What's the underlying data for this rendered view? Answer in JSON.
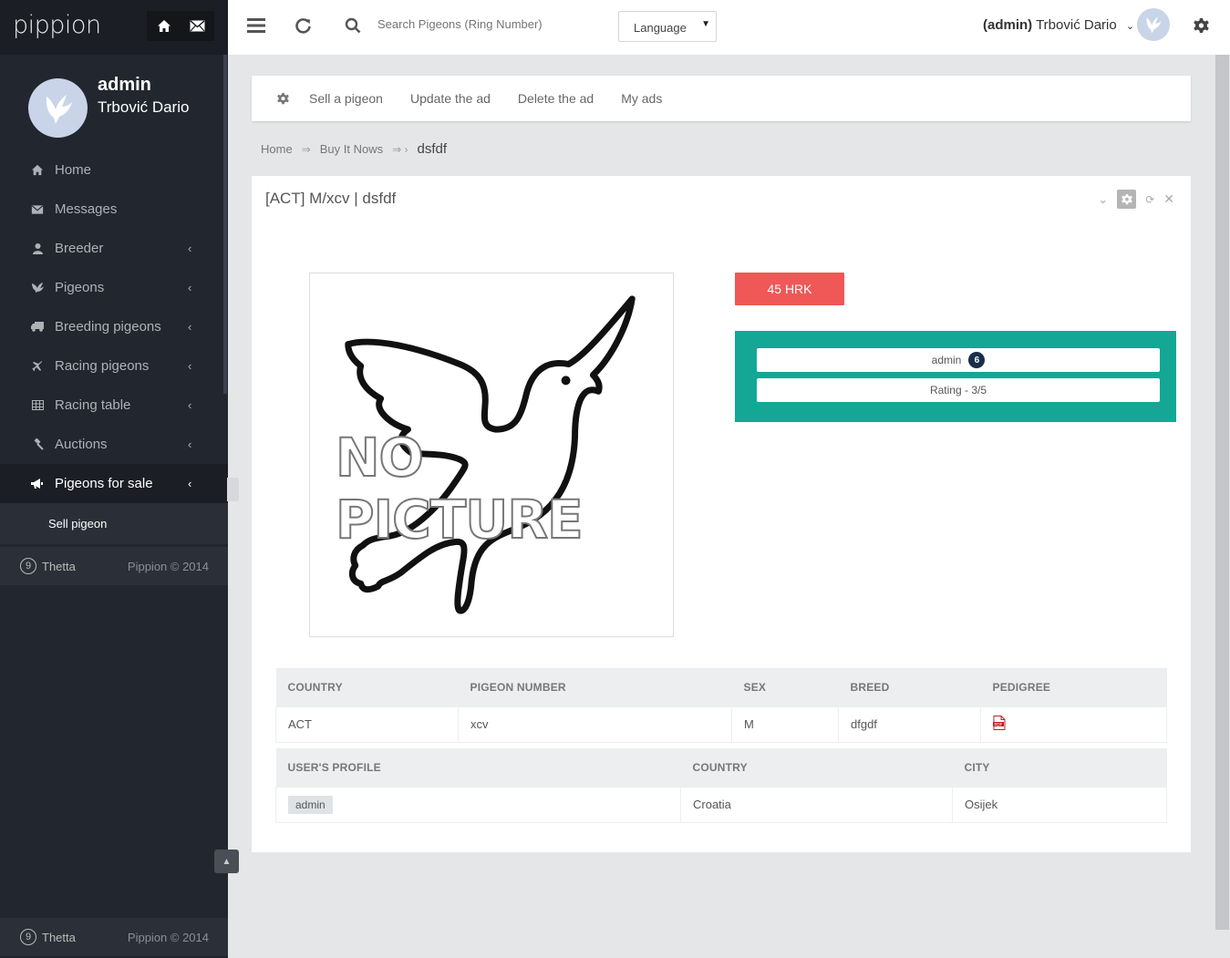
{
  "app": {
    "logo": "pippion"
  },
  "profile": {
    "username": "admin",
    "full_name": "Trbović Dario"
  },
  "sidebar": {
    "items": [
      {
        "label": "Home",
        "icon": "home-icon",
        "has_children": false
      },
      {
        "label": "Messages",
        "icon": "envelope-icon",
        "has_children": false
      },
      {
        "label": "Breeder",
        "icon": "user-icon",
        "has_children": true
      },
      {
        "label": "Pigeons",
        "icon": "bird-icon",
        "has_children": true
      },
      {
        "label": "Breeding pigeons",
        "icon": "truck-icon",
        "has_children": true
      },
      {
        "label": "Racing pigeons",
        "icon": "plane-icon",
        "has_children": true
      },
      {
        "label": "Racing table",
        "icon": "table-icon",
        "has_children": true
      },
      {
        "label": "Auctions",
        "icon": "gavel-icon",
        "has_children": true
      },
      {
        "label": "Pigeons for sale",
        "icon": "bullhorn-icon",
        "has_children": true,
        "active": true
      }
    ],
    "sub_item": "Sell pigeon",
    "footer": {
      "brand": "Thetta",
      "copyright": "Pippion © 2014"
    }
  },
  "topbar": {
    "search_placeholder": "Search Pigeons (Ring Number)",
    "language_label": "Language",
    "user_prefix": "(admin)",
    "user_name": "Trbović Dario"
  },
  "actions": [
    "Sell a pigeon",
    "Update the ad",
    "Delete the ad",
    "My ads"
  ],
  "breadcrumb": {
    "home": "Home",
    "section": "Buy It Nows",
    "current": "dsfdf"
  },
  "panel": {
    "title": "[ACT] M/xcv | dsfdf",
    "no_picture_text": "NO PICTURE",
    "price": "45 HRK",
    "seller": {
      "name": "admin",
      "count": "6",
      "rating": "Rating - 3/5"
    }
  },
  "pigeon_table": {
    "headers": [
      "COUNTRY",
      "PIGEON NUMBER",
      "SEX",
      "BREED",
      "PEDIGREE"
    ],
    "row": [
      "ACT",
      "xcv",
      "M",
      "dfgdf"
    ]
  },
  "user_table": {
    "headers": [
      "USER'S PROFILE",
      "COUNTRY",
      "CITY"
    ],
    "row": [
      "admin",
      "Croatia",
      "Osijek"
    ]
  }
}
